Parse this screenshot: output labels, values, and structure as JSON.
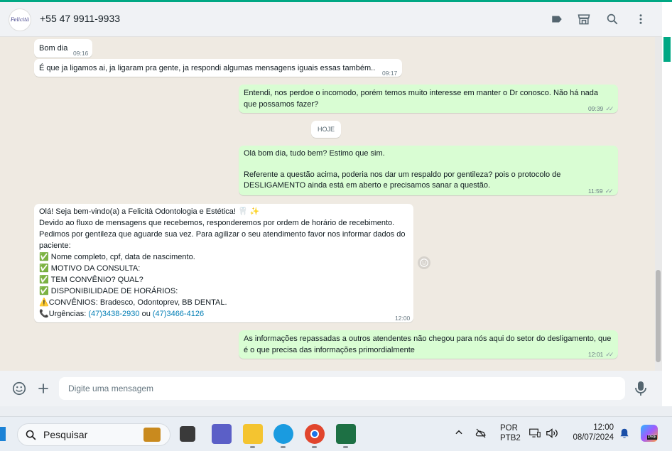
{
  "header": {
    "avatar_text": "Felicità",
    "contact_name": "+55 47 9911-9933",
    "icons": [
      "label-icon",
      "store-icon",
      "search-icon",
      "menu-icon"
    ]
  },
  "messages": {
    "m1": {
      "text": "Bom dia",
      "time": "09:16"
    },
    "m2": {
      "text": "É que ja ligamos ai, ja ligaram pra gente, ja respondi algumas mensagens iguais essas também..",
      "time": "09:17"
    },
    "m3": {
      "text": "Entendi, nos perdoe o incomodo, porém temos muito interesse em manter o Dr conosco. Não há nada que possamos fazer?",
      "time": "09:39"
    },
    "day_label": "HOJE",
    "m4": {
      "text": "Olá bom dia, tudo bem? Estimo que sim.\n\nReferente a questão acima, poderia nos dar um respaldo por gentileza? pois o protocolo de DESLIGAMENTO ainda está em aberto e precisamos sanar a questão.",
      "time": "11:59"
    },
    "m5": {
      "line1": "Olá! Seja bem-vindo(a) a Felicità Odontologia e Estética! 🦷 ✨",
      "line2": "Devido ao fluxo de mensagens que recebemos, responderemos  por ordem de horário de recebimento.",
      "line3": "Pedimos por gentileza que aguarde sua vez.  Para agilizar o seu atendimento favor nos informar dados do paciente:",
      "check1": "Nome completo, cpf, data de nascimento.",
      "check2": "MOTIVO DA CONSULTA:",
      "check3": "TEM CONVÊNIO? QUAL?",
      "check4": "DISPONIBILIDADE DE HORÁRIOS:",
      "warn": "CONVÊNIOS: Bradesco, Odontoprev, BB DENTAL.",
      "urg_label": "Urgências:",
      "phone1": "(47)3438-2930",
      "or": "ou",
      "phone2": "(47)3466-4126",
      "time": "12:00"
    },
    "m6": {
      "text": "As informações repassadas a outros atendentes não chegou para nós aqui do setor do desligamento, que é o que precisa das informações primordialmente",
      "time": "12:01"
    }
  },
  "composer": {
    "placeholder": "Digite uma mensagem"
  },
  "taskbar": {
    "search_label": "Pesquisar",
    "lang1": "POR",
    "lang2": "PTB2",
    "time": "12:00",
    "date": "08/07/2024",
    "copilot_badge": "PRE"
  },
  "colors": {
    "accent": "#00a884",
    "outgoing": "#d9fdd3",
    "incoming": "#ffffff",
    "link": "#027eb5"
  }
}
